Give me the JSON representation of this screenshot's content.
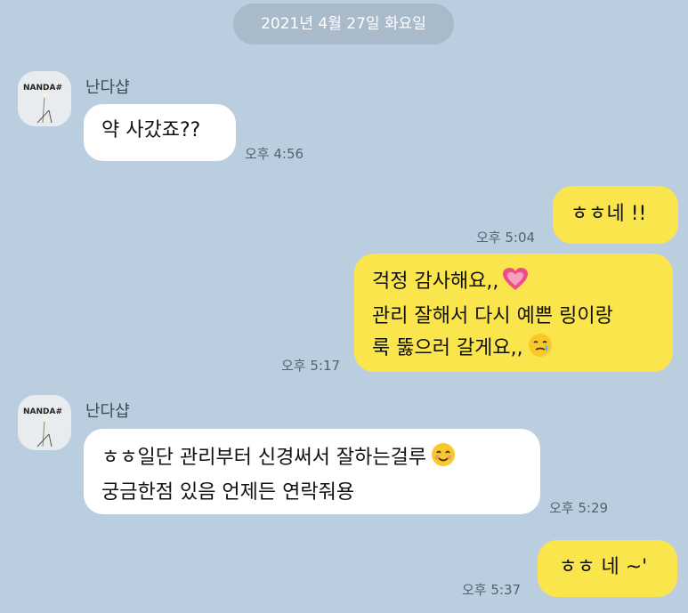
{
  "date_divider": "2021년 4월 27일 화요일",
  "avatar_text": "NANDA#",
  "messages": [
    {
      "type": "incoming",
      "sender": "난다샵",
      "lines": [
        "약 사갔죠??"
      ],
      "time": "오후 4:56"
    },
    {
      "type": "outgoing",
      "lines": [
        "ㅎㅎ네 !!"
      ],
      "time": "오후 5:04"
    },
    {
      "type": "outgoing",
      "lines": [
        "걱정 감사해요,,",
        "관리 잘해서 다시 예쁜 링이랑",
        "룩 뚫으러 갈게요,,"
      ],
      "emojis": [
        "heart-emoji",
        "tearful-smile-emoji"
      ],
      "time": "오후 5:17"
    },
    {
      "type": "incoming",
      "sender": "난다샵",
      "lines": [
        "ㅎㅎ일단 관리부터 신경써서 잘하는걸루",
        "궁금한점 있음 언제든 연락줘용"
      ],
      "emojis": [
        "smiling-emoji"
      ],
      "time": "오후 5:29"
    },
    {
      "type": "outgoing",
      "lines": [
        "ㅎㅎ 네 ~'"
      ],
      "time": "오후 5:37"
    }
  ],
  "colors": {
    "background": "#bacee0",
    "incoming_bubble": "#ffffff",
    "outgoing_bubble": "#fbe54d",
    "date_pill": "#a9bbcb"
  }
}
